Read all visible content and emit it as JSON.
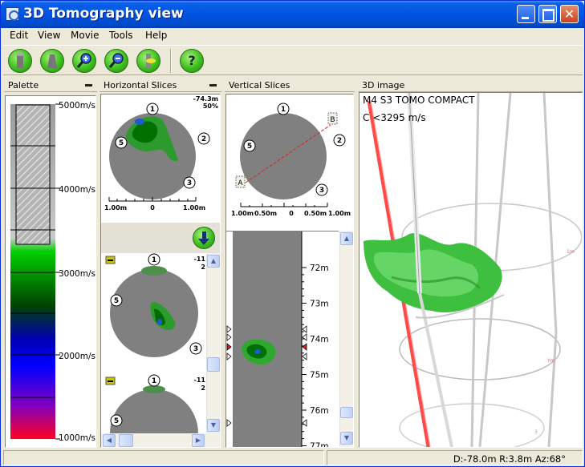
{
  "window": {
    "title": "3D Tomography view"
  },
  "menu": [
    "Edit",
    "View",
    "Movie",
    "Tools",
    "Help"
  ],
  "toolbar": {
    "tools": [
      "cylinder-icon",
      "cone-icon",
      "zoom-in-icon",
      "zoom-out-icon",
      "slice-icon",
      "help-icon"
    ],
    "help_glyph": "?"
  },
  "panels": {
    "palette": {
      "title": "Palette",
      "labels": [
        "5000m/s",
        "4000m/s",
        "3000m/s",
        "2000m/s",
        "1000m/s"
      ],
      "threshold_label_value": 3295
    },
    "horizontal": {
      "title": "Horizontal Slices",
      "top_slice": {
        "depth": "-74.3m",
        "percent": "50%",
        "markers": [
          "1",
          "2",
          "3",
          "5"
        ],
        "scale": [
          "1.00m",
          "0",
          "1.00m"
        ]
      },
      "slice2": {
        "depth": "-11",
        "sub": "2",
        "markers": [
          "1",
          "3",
          "5"
        ]
      },
      "slice3": {
        "depth": "-11",
        "sub": "2",
        "markers": [
          "1",
          "5"
        ]
      }
    },
    "vertical": {
      "title": "Vertical Slices",
      "markers": [
        "1",
        "2",
        "3",
        "5"
      ],
      "ends": [
        "A",
        "B"
      ],
      "scale": [
        "1.00m",
        "0.50m",
        "0",
        "0.50m",
        "1.00m"
      ],
      "depth_labels": [
        "72m",
        "73m",
        "74m",
        "75m",
        "76m",
        "77m"
      ],
      "depth_values": [
        72,
        73,
        74,
        75,
        76,
        77
      ]
    },
    "image3d": {
      "title": "3D image",
      "line1": "M4 S3 TOMO COMPACT",
      "line2": "C <3295 m/s"
    }
  },
  "status": {
    "text": "D:-78.0m R:3.8m Az:68°"
  }
}
